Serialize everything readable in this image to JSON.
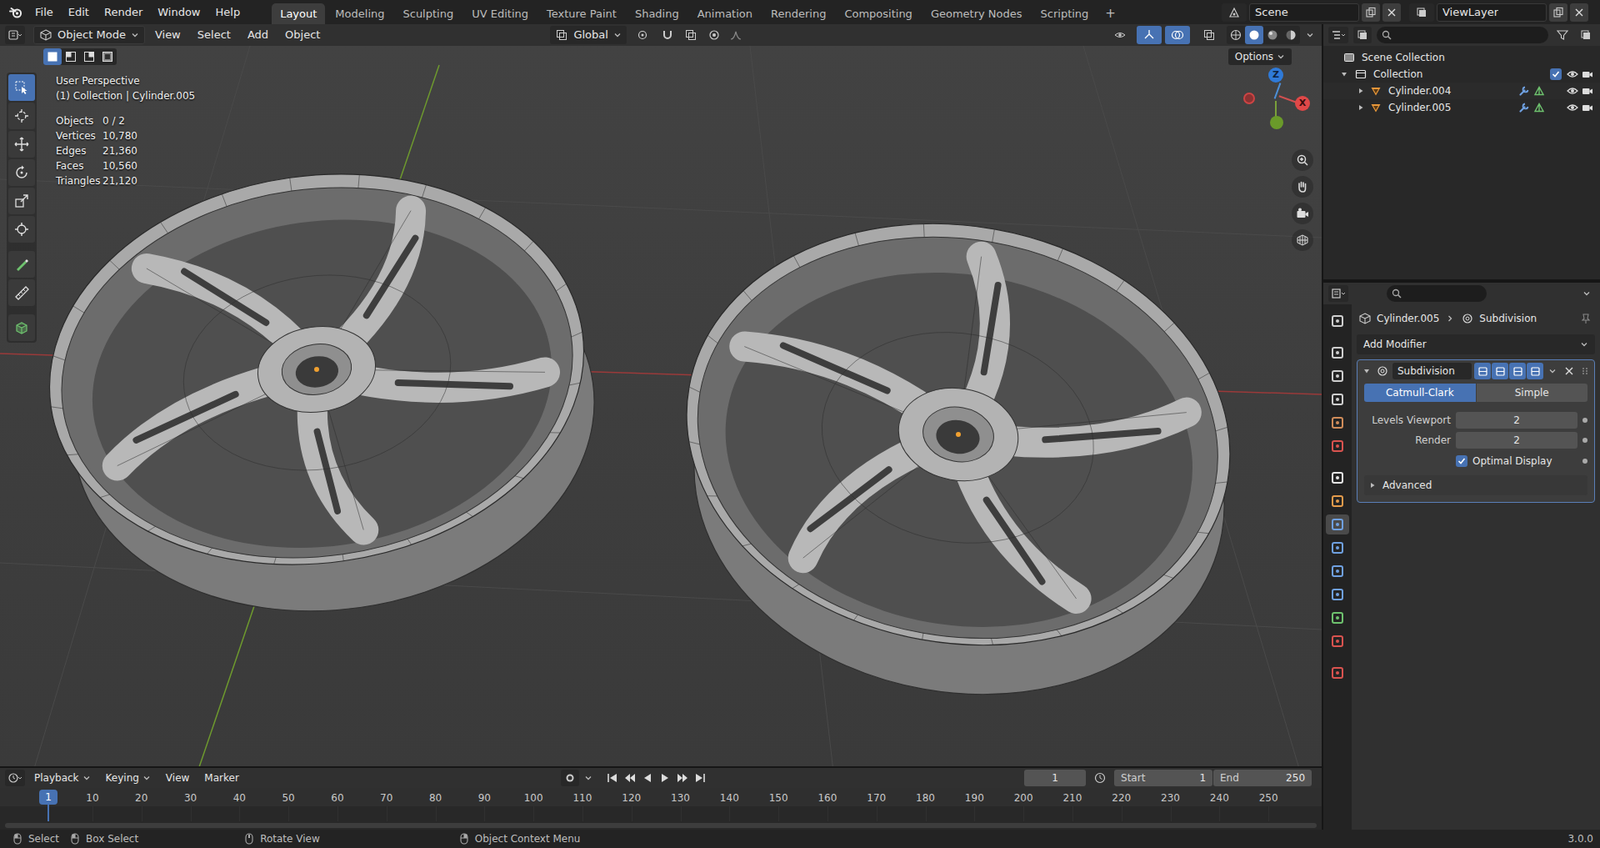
{
  "top_bar": {
    "menus": [
      "File",
      "Edit",
      "Render",
      "Window",
      "Help"
    ],
    "workspaces": [
      {
        "label": "Layout",
        "selected": true
      },
      {
        "label": "Modeling",
        "selected": false
      },
      {
        "label": "Sculpting",
        "selected": false
      },
      {
        "label": "UV Editing",
        "selected": false
      },
      {
        "label": "Texture Paint",
        "selected": false
      },
      {
        "label": "Shading",
        "selected": false
      },
      {
        "label": "Animation",
        "selected": false
      },
      {
        "label": "Rendering",
        "selected": false
      },
      {
        "label": "Compositing",
        "selected": false
      },
      {
        "label": "Geometry Nodes",
        "selected": false
      },
      {
        "label": "Scripting",
        "selected": false
      }
    ],
    "add_workspace": "+",
    "scene": "Scene",
    "view_layer": "ViewLayer"
  },
  "viewport": {
    "header": {
      "mode": "Object Mode",
      "menus": [
        "View",
        "Select",
        "Add",
        "Object"
      ],
      "orientation": "Global"
    },
    "options": "Options",
    "select_modes": [
      {
        "selected": true
      },
      {
        "selected": false
      },
      {
        "selected": false
      },
      {
        "selected": false
      }
    ],
    "tools": [
      {
        "selected": true
      },
      {
        "selected": false
      },
      {
        "selected": false
      },
      {
        "selected": false
      },
      {
        "selected": false
      },
      {
        "selected": false
      },
      {
        "selected": false
      },
      {
        "selected": false
      },
      {
        "selected": false
      }
    ],
    "info": {
      "perspective": "User Perspective",
      "context": "(1) Collection | Cylinder.005",
      "stats": [
        {
          "label": "Objects",
          "value": "0 / 2"
        },
        {
          "label": "Vertices",
          "value": "10,780"
        },
        {
          "label": "Edges",
          "value": "21,360"
        },
        {
          "label": "Faces",
          "value": "10,560"
        },
        {
          "label": "Triangles",
          "value": "21,120"
        }
      ]
    },
    "gizmo": {
      "z": "Z",
      "x": "X"
    }
  },
  "outliner": {
    "root": "Scene Collection",
    "collection": {
      "label": "Collection",
      "expanded": true,
      "checked": true,
      "visible": true,
      "renderable": true,
      "objects": [
        {
          "label": "Cylinder.004",
          "expanded": false,
          "visible": true,
          "renderable": true
        },
        {
          "label": "Cylinder.005",
          "expanded": false,
          "visible": true,
          "renderable": true
        }
      ]
    }
  },
  "properties": {
    "tabs": [
      {
        "selected": false,
        "color": "#cfcfcf"
      },
      {
        "selected": false,
        "color": "#cfcfcf"
      },
      {
        "selected": false,
        "color": "#cfcfcf"
      },
      {
        "selected": false,
        "color": "#cfcfcf"
      },
      {
        "selected": false,
        "color": "#d08c5a"
      },
      {
        "selected": false,
        "color": "#d9534f"
      },
      {
        "selected": false,
        "color": "#e6e6e6"
      },
      {
        "selected": false,
        "color": "#e49b4b"
      },
      {
        "selected": true,
        "color": "#6fa0e0"
      },
      {
        "selected": false,
        "color": "#6fa0e0"
      },
      {
        "selected": false,
        "color": "#6fa0e0"
      },
      {
        "selected": false,
        "color": "#6fa0e0"
      },
      {
        "selected": false,
        "color": "#6ec26e"
      },
      {
        "selected": false,
        "color": "#d9534f"
      },
      {
        "selected": false,
        "color": "#d9534f"
      }
    ],
    "breadcrumb": [
      "Cylinder.005",
      "Subdivision"
    ],
    "add_modifier": "Add Modifier",
    "modifier": {
      "name": "Subdivision",
      "expanded": true,
      "toggles": [
        {
          "on": true
        },
        {
          "on": true
        },
        {
          "on": true
        },
        {
          "on": true
        }
      ],
      "types": [
        {
          "label": "Catmull-Clark",
          "selected": true
        },
        {
          "label": "Simple",
          "selected": false
        }
      ],
      "fields": [
        {
          "label": "Levels Viewport",
          "value": "2"
        },
        {
          "label": "Render",
          "value": "2"
        }
      ],
      "optimal_display": {
        "label": "Optimal Display",
        "checked": true
      },
      "advanced": {
        "label": "Advanced",
        "expanded": false
      }
    }
  },
  "timeline": {
    "menus": [
      "Playback",
      "Keying",
      "View",
      "Marker"
    ],
    "current_frame": "1",
    "start_label": "Start",
    "start": "1",
    "end_label": "End",
    "end": "250",
    "playhead": "1",
    "ticks": [
      "10",
      "20",
      "30",
      "40",
      "50",
      "60",
      "70",
      "80",
      "90",
      "100",
      "110",
      "120",
      "130",
      "140",
      "150",
      "160",
      "170",
      "180",
      "190",
      "200",
      "210",
      "220",
      "230",
      "240",
      "250"
    ]
  },
  "status_bar": {
    "items": [
      "Select",
      "Box Select",
      "Rotate View",
      "Object Context Menu"
    ],
    "version": "3.0.0"
  }
}
